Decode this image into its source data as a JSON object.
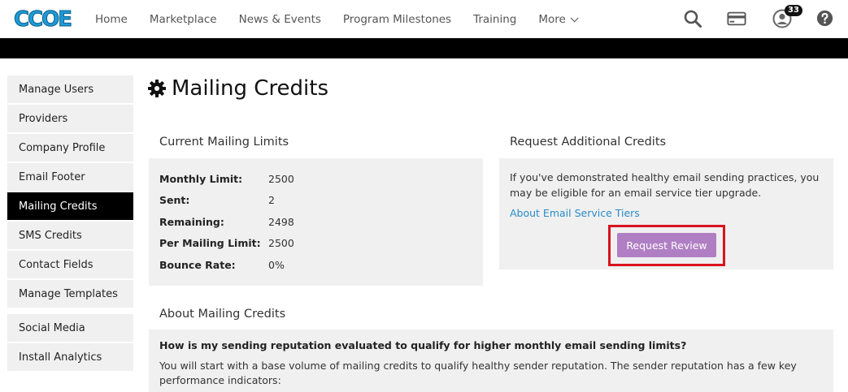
{
  "brand": {
    "logo_text": "CCOE"
  },
  "nav": {
    "items": [
      "Home",
      "Marketplace",
      "News & Events",
      "Program Milestones",
      "Training"
    ],
    "more_label": "More",
    "notification_count": "33"
  },
  "sidebar": {
    "items": [
      {
        "label": "Manage Users",
        "active": false
      },
      {
        "label": "Providers",
        "active": false
      },
      {
        "label": "Company Profile",
        "active": false
      },
      {
        "label": "Email Footer",
        "active": false
      },
      {
        "label": "Mailing Credits",
        "active": true
      },
      {
        "label": "SMS Credits",
        "active": false
      },
      {
        "label": "Contact Fields",
        "active": false
      },
      {
        "label": "Manage Templates",
        "active": false
      }
    ],
    "items2": [
      {
        "label": "Social Media"
      },
      {
        "label": "Install Analytics"
      }
    ]
  },
  "page": {
    "title": "Mailing Credits"
  },
  "limits": {
    "heading": "Current Mailing Limits",
    "rows": [
      {
        "label": "Monthly Limit:",
        "value": "2500"
      },
      {
        "label": "Sent:",
        "value": "2"
      },
      {
        "label": "Remaining:",
        "value": "2498"
      },
      {
        "label": "Per Mailing Limit:",
        "value": "2500"
      },
      {
        "label": "Bounce Rate:",
        "value": "0%"
      }
    ]
  },
  "request": {
    "heading": "Request Additional Credits",
    "text": "If you've demonstrated healthy email sending practices, you may be eligible for an email service tier upgrade.",
    "link": "About Email Service Tiers",
    "button": "Request Review"
  },
  "about": {
    "heading": "About Mailing Credits",
    "question": "How is my sending reputation evaluated to qualify for higher monthly email sending limits?",
    "answer": "You will start with a base volume of mailing credits to qualify healthy sender reputation. The sender reputation has a few key performance indicators:"
  },
  "colors": {
    "accent_button": "#b07fc3",
    "highlight_box": "#d9131f",
    "link": "#2a8bc9",
    "active_nav": "#000000"
  },
  "icons": [
    "search-icon",
    "credit-card-icon",
    "user-icon",
    "help-icon",
    "gear-icon",
    "chevron-down-icon"
  ]
}
